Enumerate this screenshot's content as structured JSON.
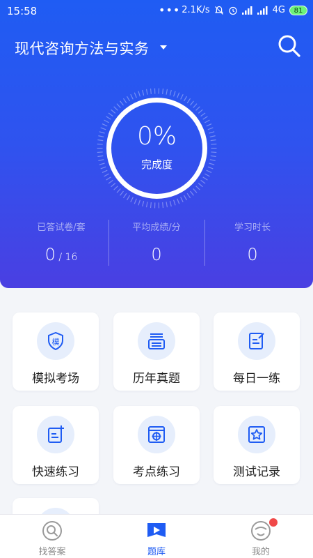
{
  "status": {
    "time": "15:58",
    "dots": "•••",
    "speed": "2.1K/s",
    "network": "4G",
    "battery": "81"
  },
  "header": {
    "title": "现代咨询方法与实务"
  },
  "progress": {
    "percent_text": "0%",
    "label": "完成度",
    "value": 0
  },
  "stats": [
    {
      "label": "已答试卷/套",
      "value": "0",
      "sub": " / 16"
    },
    {
      "label": "平均成绩/分",
      "value": "0",
      "sub": ""
    },
    {
      "label": "学习时长",
      "value": "0",
      "sub": ""
    }
  ],
  "features": [
    {
      "label": "模拟考场",
      "icon": "mock-exam-icon"
    },
    {
      "label": "历年真题",
      "icon": "past-papers-icon"
    },
    {
      "label": "每日一练",
      "icon": "daily-practice-icon"
    },
    {
      "label": "快速练习",
      "icon": "quick-practice-icon"
    },
    {
      "label": "考点练习",
      "icon": "key-points-icon"
    },
    {
      "label": "测试记录",
      "icon": "test-record-icon"
    }
  ],
  "nav": [
    {
      "label": "找答案",
      "icon": "search-answer-icon"
    },
    {
      "label": "题库",
      "icon": "question-bank-icon"
    },
    {
      "label": "我的",
      "icon": "profile-icon"
    }
  ],
  "colors": {
    "primary": "#1f5cf3",
    "gradient_end": "#4a3fe2",
    "icon_bg": "#e6eefc",
    "badge": "#f04848"
  }
}
